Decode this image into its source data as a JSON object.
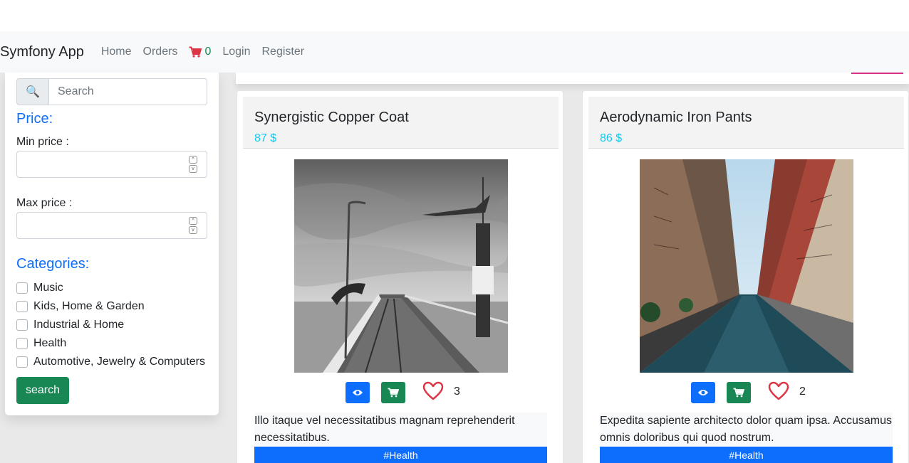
{
  "nav": {
    "brand": "Symfony App",
    "links": [
      "Home",
      "Orders"
    ],
    "cart_count": "0",
    "auth_links": [
      "Login",
      "Register"
    ]
  },
  "sidebar": {
    "search_placeholder": "Search",
    "price_title": "Price:",
    "min_price_label": "Min price :",
    "max_price_label": "Max price :",
    "categories_title": "Categories:",
    "categories": [
      "Music",
      "Kids, Home & Garden",
      "Industrial & Home",
      "Health",
      "Automotive, Jewelry & Computers"
    ],
    "search_button": "search"
  },
  "products": [
    {
      "name": "Synergistic Copper Coat",
      "price": "87 $",
      "likes": "3",
      "description": "Illo itaque vel necessitatibus magnam reprehenderit necessitatibus.",
      "tag": "#Health",
      "image_icon": "pier-photo"
    },
    {
      "name": "Aerodynamic Iron Pants",
      "price": "86 $",
      "likes": "2",
      "description": "Expedita sapiente architecto dolor quam ipsa. Accusamus omnis doloribus qui quod nostrum.",
      "tag": "#Health",
      "image_icon": "city-street-photo"
    }
  ],
  "colors": {
    "primary": "#0d6efd",
    "success": "#198754",
    "info": "#0dcaf0",
    "danger": "#dc3545"
  }
}
